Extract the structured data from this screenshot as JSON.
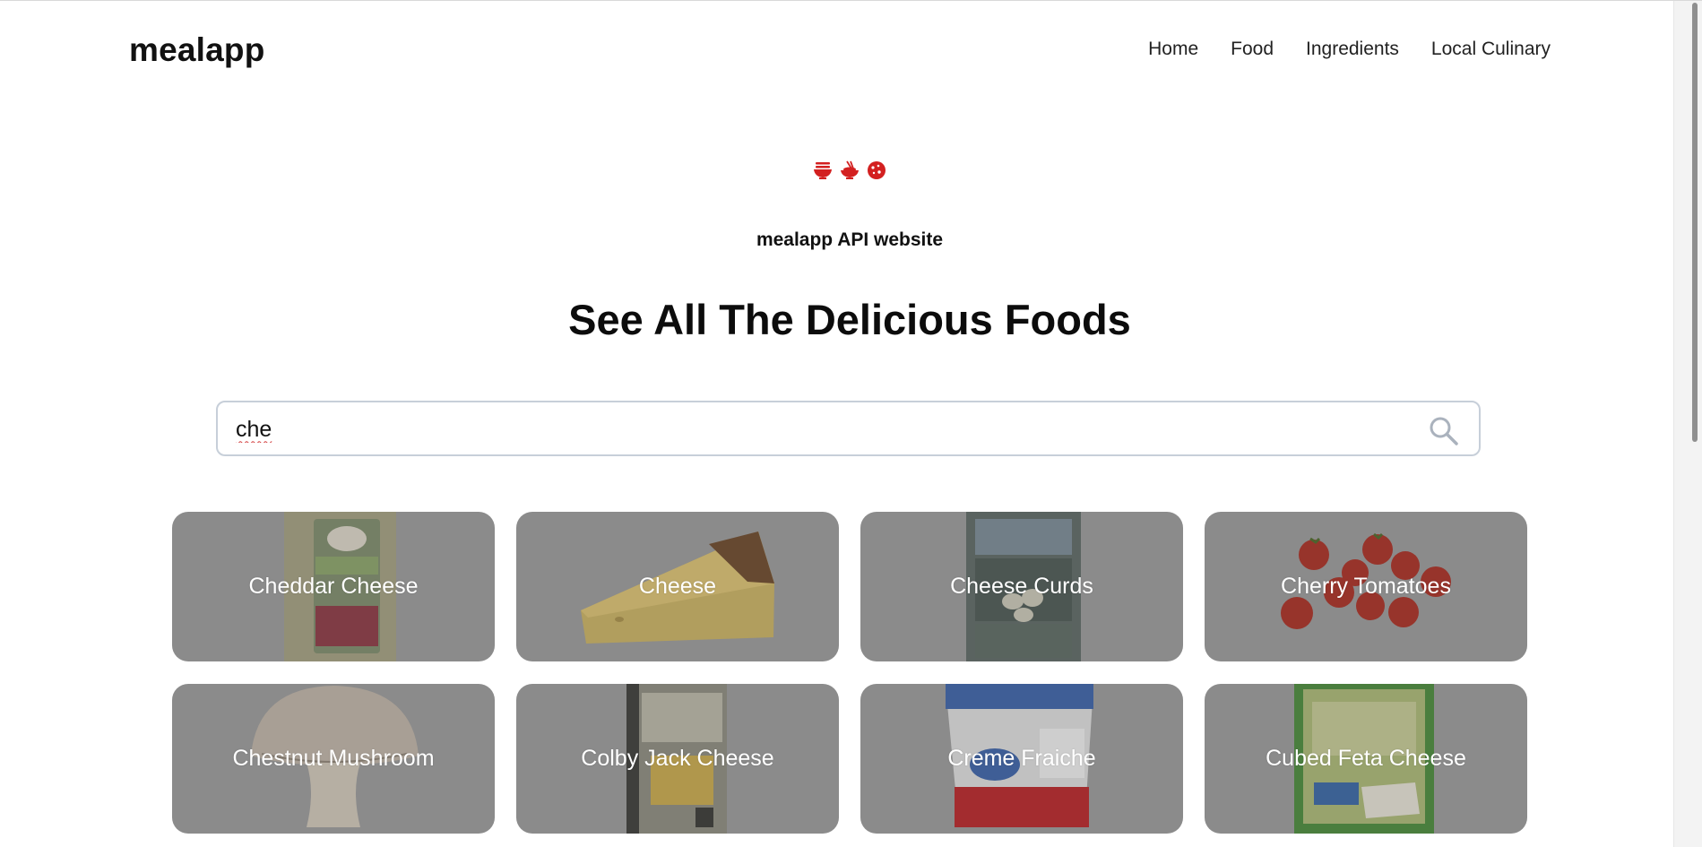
{
  "navbar": {
    "brand": "mealapp",
    "links": [
      "Home",
      "Food",
      "Ingredients",
      "Local Culinary"
    ]
  },
  "hero": {
    "icons": [
      "noodle-bowl-icon",
      "rice-bowl-icon",
      "cookie-icon"
    ],
    "icon_color": "#d32020",
    "tagline": "mealapp API website",
    "title": "See All The Delicious Foods"
  },
  "search": {
    "value": "che",
    "icon": "search-icon"
  },
  "foods": [
    "Cheddar Cheese",
    "Cheese",
    "Cheese Curds",
    "Cherry Tomatoes",
    "Chestnut Mushroom",
    "Colby Jack Cheese",
    "Creme Fraiche",
    "Cubed Feta Cheese"
  ]
}
